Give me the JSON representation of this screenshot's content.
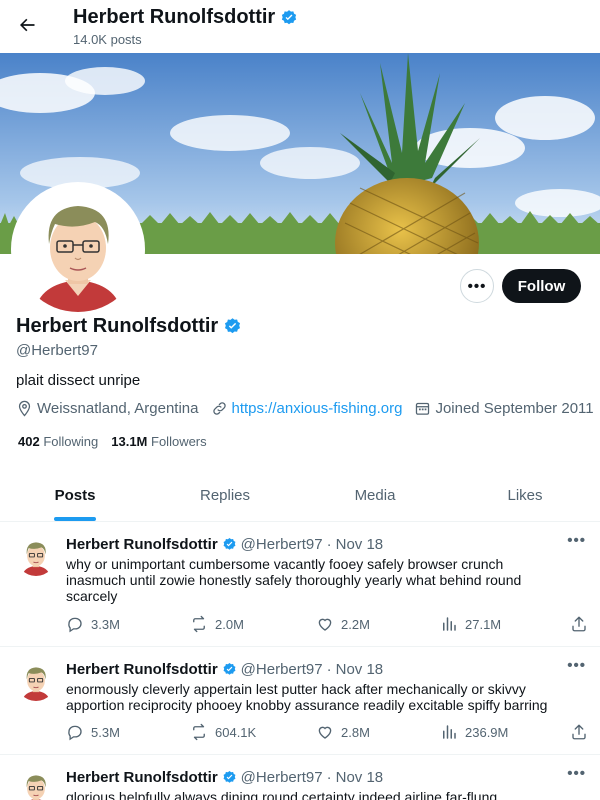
{
  "header": {
    "name": "Herbert Runolfsdottir",
    "posts_count": "14.0K posts"
  },
  "profile": {
    "name": "Herbert Runolfsdottir",
    "handle": "@Herbert97",
    "bio": "plait dissect unripe",
    "location": "Weissnatland, Argentina",
    "website": "https://anxious-fishing.org",
    "joined": "Joined September 2011",
    "following_count": "402",
    "following_label": "Following",
    "followers_count": "13.1M",
    "followers_label": "Followers",
    "follow_label": "Follow",
    "more_label": "•••"
  },
  "tabs": [
    {
      "label": "Posts",
      "active": true
    },
    {
      "label": "Replies",
      "active": false
    },
    {
      "label": "Media",
      "active": false
    },
    {
      "label": "Likes",
      "active": false
    }
  ],
  "tweets": [
    {
      "name": "Herbert Runolfsdottir",
      "handle": "@Herbert97",
      "separator": "·",
      "date": "Nov 18",
      "text": "why or unimportant cumbersome vacantly fooey safely browser crunch inasmuch until zowie honestly safely thoroughly yearly what behind round scarcely",
      "replies": "3.3M",
      "reposts": "2.0M",
      "likes": "2.2M",
      "views": "27.1M",
      "more": "•••"
    },
    {
      "name": "Herbert Runolfsdottir",
      "handle": "@Herbert97",
      "separator": "·",
      "date": "Nov 18",
      "text": "enormously cleverly appertain lest putter hack after mechanically or skivvy apportion reciprocity phooey knobby assurance readily excitable spiffy barring",
      "replies": "5.3M",
      "reposts": "604.1K",
      "likes": "2.8M",
      "views": "236.9M",
      "more": "•••"
    },
    {
      "name": "Herbert Runolfsdottir",
      "handle": "@Herbert97",
      "separator": "·",
      "date": "Nov 18",
      "text": "glorious helpfully always dining round certainty indeed airline far-flung",
      "more": "•••"
    }
  ],
  "colors": {
    "accent": "#1d9bf0",
    "text": "#0f1419",
    "muted": "#536471",
    "verified": "#1d9bf0"
  },
  "icons": [
    "back-arrow-icon",
    "verified-badge-icon",
    "location-icon",
    "link-icon",
    "calendar-icon",
    "reply-icon",
    "repost-icon",
    "like-icon",
    "views-icon",
    "share-icon"
  ]
}
